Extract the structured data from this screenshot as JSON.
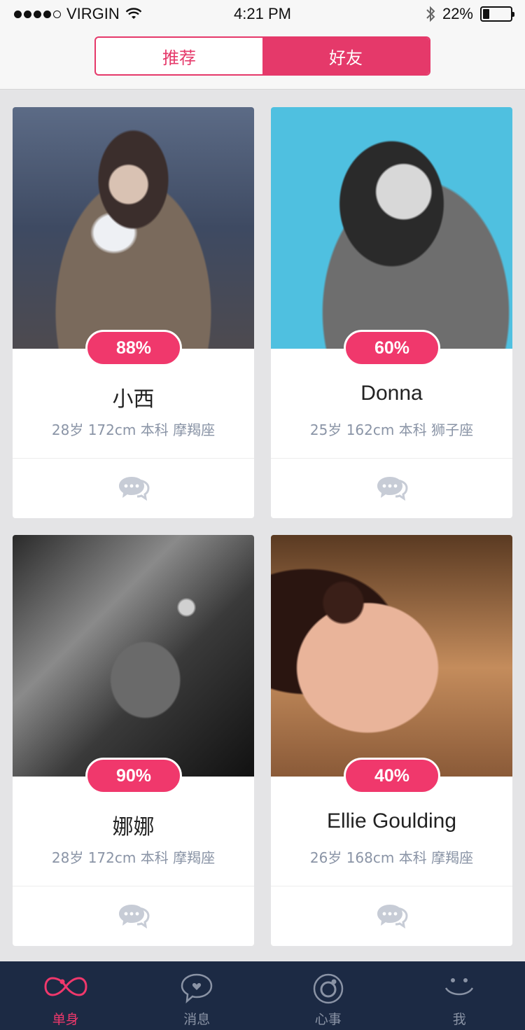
{
  "status_bar": {
    "carrier": "VIRGIN",
    "time": "4:21 PM",
    "battery": "22%"
  },
  "segment": {
    "items": [
      {
        "label": "推荐",
        "active": false
      },
      {
        "label": "好友",
        "active": true
      }
    ]
  },
  "cards": [
    {
      "match": "88%",
      "name": "小西",
      "info": "28岁  172cm  本科  摩羯座"
    },
    {
      "match": "60%",
      "name": "Donna",
      "info": "25岁  162cm  本科  狮子座"
    },
    {
      "match": "90%",
      "name": "娜娜",
      "info": "28岁  172cm  本科  摩羯座"
    },
    {
      "match": "40%",
      "name": "Ellie Goulding",
      "info": "26岁  168cm  本科  摩羯座"
    }
  ],
  "tabbar": {
    "items": [
      {
        "label": "单身",
        "icon": "infinity-icon",
        "active": true
      },
      {
        "label": "消息",
        "icon": "message-heart-icon",
        "active": false
      },
      {
        "label": "心事",
        "icon": "circle-icon",
        "active": false
      },
      {
        "label": "我",
        "icon": "smile-icon",
        "active": false
      }
    ]
  },
  "colors": {
    "accent": "#f0386c",
    "segment": "#e5396a",
    "tabbar_bg": "#1c2a44",
    "info_text": "#8a94a6"
  }
}
